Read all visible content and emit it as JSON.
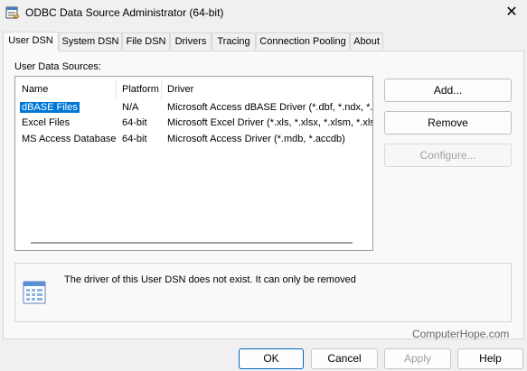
{
  "window": {
    "title": "ODBC Data Source Administrator (64-bit)",
    "close_glyph": "✕"
  },
  "tabs": [
    {
      "label": "User DSN",
      "active": true
    },
    {
      "label": "System DSN"
    },
    {
      "label": "File DSN"
    },
    {
      "label": "Drivers"
    },
    {
      "label": "Tracing"
    },
    {
      "label": "Connection Pooling"
    },
    {
      "label": "About"
    }
  ],
  "section_label": "User Data Sources:",
  "table": {
    "columns": [
      "Name",
      "Platform",
      "Driver"
    ],
    "rows": [
      {
        "name": "dBASE Files",
        "platform": "N/A",
        "driver": "Microsoft Access dBASE Driver (*.dbf, *.ndx, *.m",
        "selected": true
      },
      {
        "name": "Excel Files",
        "platform": "64-bit",
        "driver": "Microsoft Excel Driver (*.xls, *.xlsx, *.xlsm, *.xlsb)"
      },
      {
        "name": "MS Access Database",
        "platform": "64-bit",
        "driver": "Microsoft Access Driver (*.mdb, *.accdb)"
      }
    ]
  },
  "buttons": {
    "add": "Add...",
    "remove": "Remove",
    "configure": "Configure..."
  },
  "info_message": "The driver of this User DSN does not exist. It can only be removed",
  "watermark": "ComputerHope.com",
  "footer": {
    "ok": "OK",
    "cancel": "Cancel",
    "apply": "Apply",
    "help": "Help"
  },
  "icons": {
    "app": "odbc-database-icon",
    "info": "data-source-icon"
  }
}
